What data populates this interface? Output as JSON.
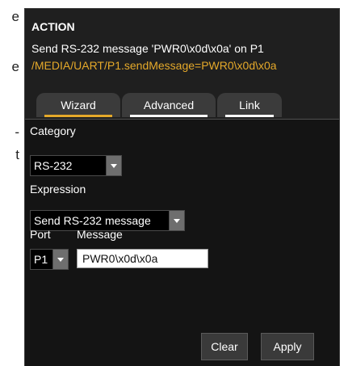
{
  "left_fragments": [
    "e",
    "e",
    "-",
    "t"
  ],
  "action": {
    "title": "ACTION",
    "description": "Send RS-232 message 'PWR0\\x0d\\x0a' on P1",
    "command": "/MEDIA/UART/P1.sendMessage=PWR0\\x0d\\x0a"
  },
  "tabs": [
    {
      "label": "Wizard"
    },
    {
      "label": "Advanced"
    },
    {
      "label": "Link"
    }
  ],
  "form": {
    "category_label": "Category",
    "category_value": "RS-232",
    "expression_label": "Expression",
    "expression_value": "Send RS-232 message",
    "port_label": "Port",
    "port_value": "P1",
    "message_label": "Message",
    "message_value": "PWR0\\x0d\\x0a"
  },
  "buttons": {
    "clear": "Clear",
    "apply": "Apply"
  },
  "colors": {
    "accent": "#e5a92a",
    "panel_bg": "#1f1f1f",
    "content_bg": "#141414"
  }
}
